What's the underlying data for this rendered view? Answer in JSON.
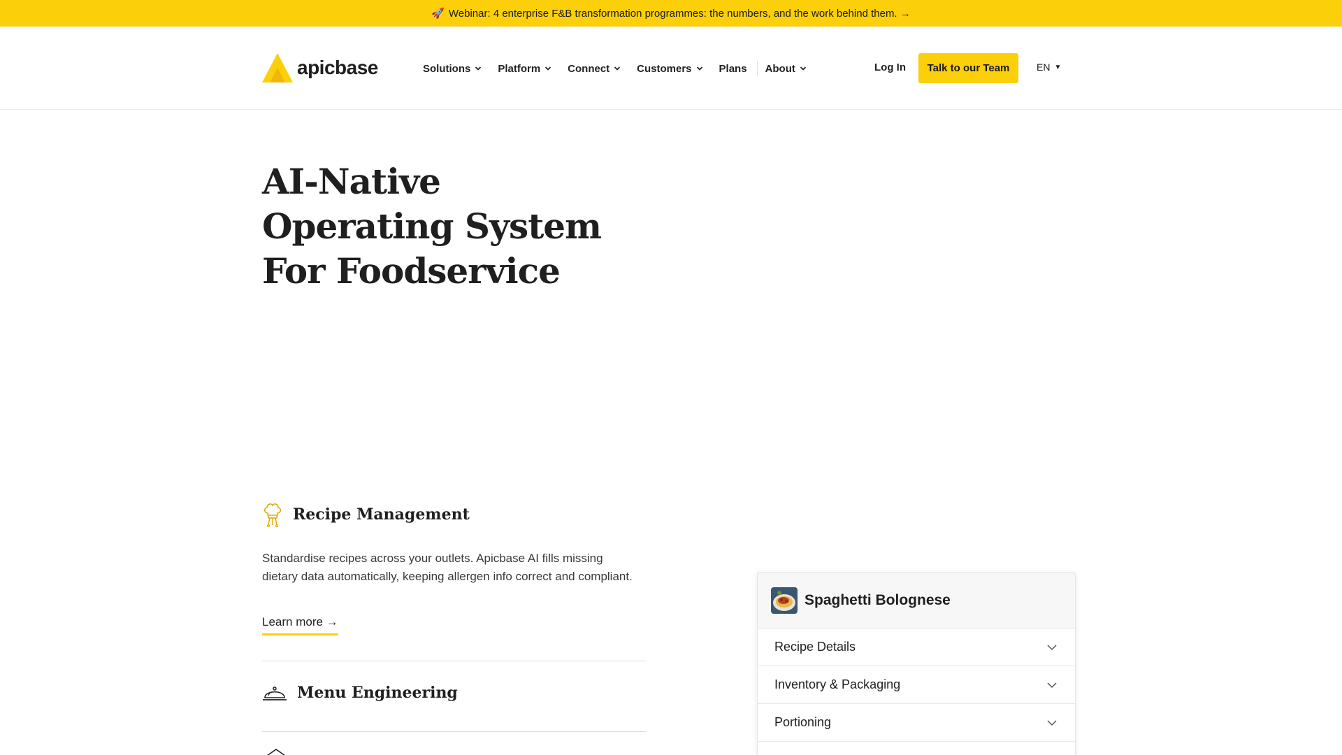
{
  "banner": {
    "icon": "rocket-icon",
    "text": "Webinar: 4 enterprise F&B transformation programmes: the numbers, and the work behind them. →"
  },
  "header": {
    "logo_text": "apicbase",
    "brand_color": "#fccf0b",
    "nav": [
      {
        "label": "Solutions",
        "has_dropdown": true
      },
      {
        "label": "Platform",
        "has_dropdown": true
      },
      {
        "label": "Connect",
        "has_dropdown": true
      },
      {
        "label": "Customers",
        "has_dropdown": true
      },
      {
        "label": "Plans",
        "has_dropdown": false
      },
      {
        "label": "About",
        "has_dropdown": true
      }
    ],
    "login_label": "Log In",
    "cta_label": "Talk to our Team",
    "language": "EN"
  },
  "hero": {
    "title_lines": [
      "AI-Native",
      "Operating System",
      "For Foodservice"
    ]
  },
  "features": [
    {
      "icon": "chef-hat-icon",
      "title": "Recipe Management",
      "description": "Standardise recipes across your outlets. Apicbase AI fills missing dietary data automatically, keeping allergen info correct and compliant.",
      "link": "Learn more →"
    },
    {
      "icon": "cloche-icon",
      "title": "Menu Engineering"
    }
  ],
  "recipe_card": {
    "title": "Spaghetti Bolognese",
    "thumb_icon": "spaghetti-dish-image",
    "sections": [
      "Recipe Details",
      "Inventory & Packaging",
      "Portioning"
    ]
  }
}
